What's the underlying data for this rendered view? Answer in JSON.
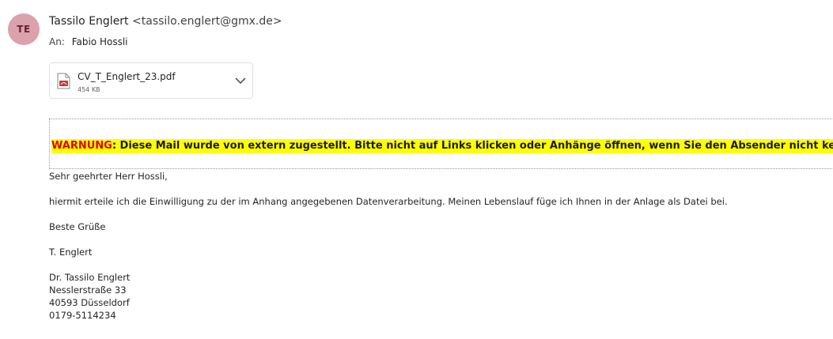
{
  "message": {
    "sender_initials": "TE",
    "sender_name": "Tassilo Englert",
    "sender_email": "<tassilo.englert@gmx.de>",
    "to_label": "An:",
    "to_name": "Fabio Hossli"
  },
  "attachment": {
    "file_name": "CV_T_Englert_23.pdf",
    "file_size": "454 KB",
    "icon": "pdf-file-icon"
  },
  "warning": {
    "label": "WARNUNG",
    "text": ": Diese Mail wurde von extern zugestellt. Bitte nicht auf Links klicken oder Anhänge öffnen, wenn Sie den Absender nicht kennen"
  },
  "body": {
    "greeting": "Sehr geehrter Herr Hossli,",
    "paragraph": "hiermit erteile ich die Einwilligung zu der im Anhang angegebenen Datenverarbeitung. Meinen Lebenslauf füge ich Ihnen in der Anlage als Datei bei.",
    "closing": "Beste Grüße",
    "short_name": "T. Englert",
    "signature": {
      "name": "Dr. Tassilo Englert",
      "street": "Nesslerstraße 33",
      "city": "40593 Düsseldorf",
      "phone": "0179-5114234"
    }
  },
  "colors": {
    "avatar_bg": "#dba1ad",
    "warning_highlight": "#ffff00",
    "warning_label": "#e00000"
  }
}
